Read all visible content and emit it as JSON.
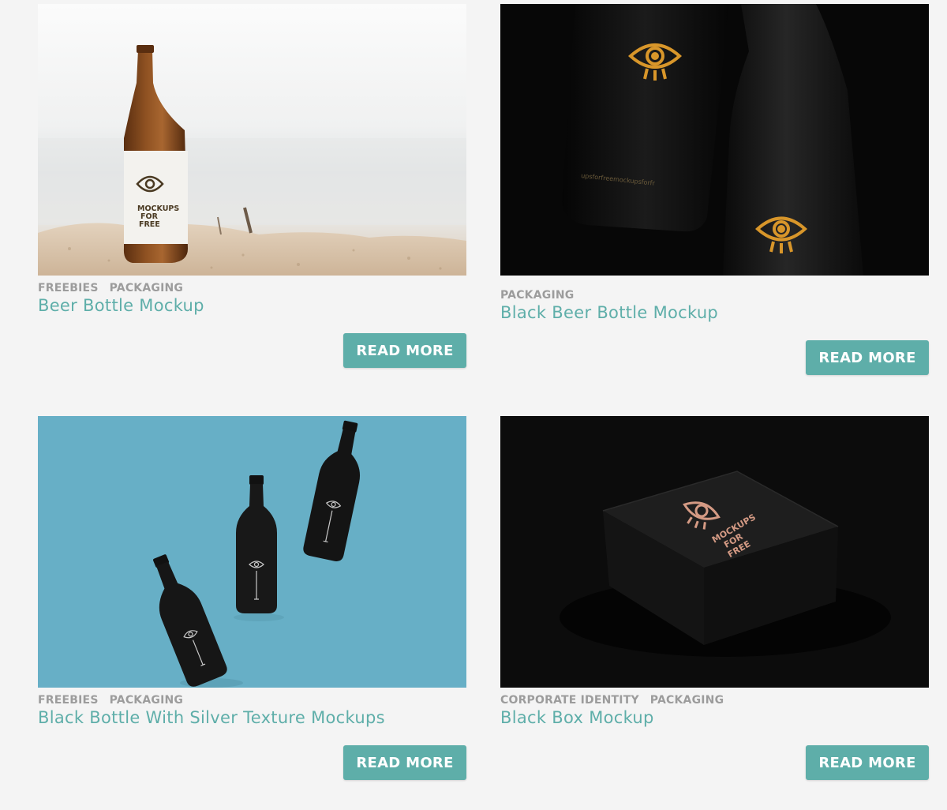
{
  "posts": [
    {
      "categories": [
        "FREEBIES",
        "PACKAGING"
      ],
      "title": "Beer Bottle Mockup",
      "button_label": "READ MORE",
      "image": {
        "scene": "amber-bottle-on-beach",
        "label_text": "MOCKUPS FOR FREE"
      }
    },
    {
      "categories": [
        "PACKAGING"
      ],
      "title": "Black Beer Bottle Mockup",
      "button_label": "READ MORE",
      "image": {
        "scene": "black-bottles-gold-eye",
        "label_text": "upsforfreemockupsforfr"
      }
    },
    {
      "categories": [
        "FREEBIES",
        "PACKAGING"
      ],
      "title": "Black Bottle With Silver Texture Mockups",
      "button_label": "READ MORE",
      "image": {
        "scene": "three-black-bottles-blue"
      }
    },
    {
      "categories": [
        "CORPORATE IDENTITY",
        "PACKAGING"
      ],
      "title": "Black Box Mockup",
      "button_label": "READ MORE",
      "image": {
        "scene": "black-box-copper-logo",
        "label_text": "MOCKUPS FOR FREE"
      }
    }
  ],
  "colors": {
    "accent": "#5eaea9",
    "category_text": "#9c9c9c",
    "page_background": "#f4f4f4",
    "button_text": "#ffffff"
  }
}
